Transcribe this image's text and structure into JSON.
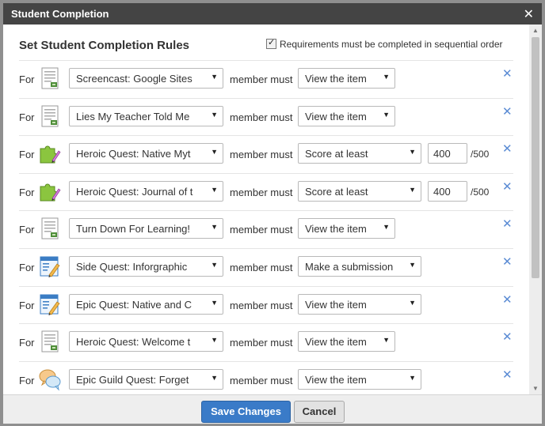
{
  "dialog": {
    "title": "Student Completion",
    "close_icon": "close-icon"
  },
  "header": {
    "title": "Set Student Completion Rules",
    "sequential_label": "Requirements must be completed in sequential order",
    "sequential_checked": true
  },
  "labels": {
    "for": "For",
    "member_must": "member must"
  },
  "rules": [
    {
      "icon": "document-icon",
      "item": "Screencast: Google Sites",
      "requirement": "View the item"
    },
    {
      "icon": "document-icon",
      "item": "Lies My Teacher Told Me",
      "requirement": "View the item"
    },
    {
      "icon": "puzzle-icon",
      "item": "Heroic Quest: Native Myt",
      "requirement": "Score at least",
      "score": "400",
      "max_score": "/500"
    },
    {
      "icon": "puzzle-icon",
      "item": "Heroic Quest: Journal of t",
      "requirement": "Score at least",
      "score": "400",
      "max_score": "/500"
    },
    {
      "icon": "document-icon",
      "item": "Turn Down For Learning!",
      "requirement": "View the item"
    },
    {
      "icon": "assignment-icon",
      "item": "Side Quest: Inforgraphic",
      "requirement": "Make a submission"
    },
    {
      "icon": "assignment-icon",
      "item": "Epic Quest: Native and C",
      "requirement": "View the item"
    },
    {
      "icon": "document-icon",
      "item": "Heroic Quest: Welcome t",
      "requirement": "View the item"
    },
    {
      "icon": "discussion-icon",
      "item": "Epic Guild Quest: Forget",
      "requirement": "View the item"
    }
  ],
  "footer": {
    "save_label": "Save Changes",
    "cancel_label": "Cancel"
  },
  "colors": {
    "title_bar": "#444444",
    "primary_button": "#3a7bc8",
    "remove_icon": "#5a8bd4"
  }
}
